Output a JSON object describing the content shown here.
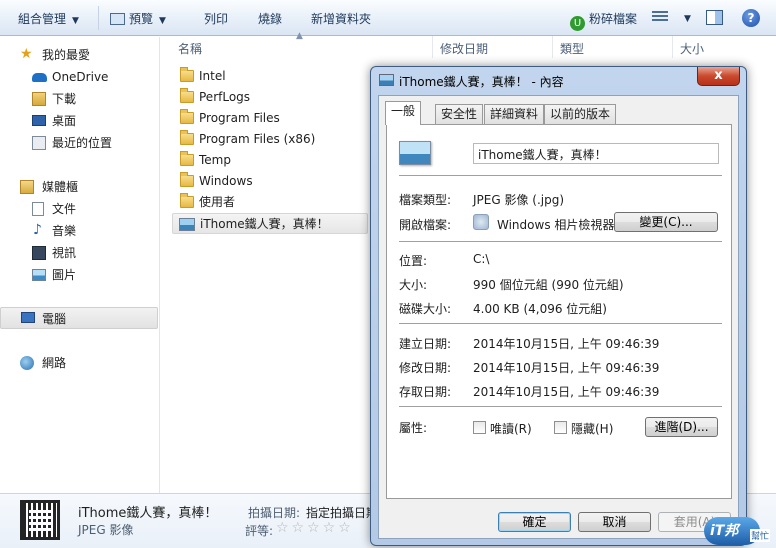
{
  "toolbar": {
    "organize": "組合管理",
    "preview": "預覽",
    "print": "列印",
    "burn": "燒錄",
    "new_folder": "新增資料夾",
    "shred": "粉碎檔案",
    "help": "?"
  },
  "sidebar": {
    "favorites": "我的最愛",
    "onedrive": "OneDrive",
    "downloads": "下載",
    "desktop": "桌面",
    "recent": "最近的位置",
    "libraries": "媒體櫃",
    "documents": "文件",
    "music": "音樂",
    "videos": "視訊",
    "pictures": "圖片",
    "computer": "電腦",
    "network": "網路"
  },
  "columns": {
    "name": "名稱",
    "modified": "修改日期",
    "type": "類型",
    "size": "大小"
  },
  "files": [
    {
      "name": "Intel",
      "kind": "folder"
    },
    {
      "name": "PerfLogs",
      "kind": "folder"
    },
    {
      "name": "Program Files",
      "kind": "folder"
    },
    {
      "name": "Program Files (x86)",
      "kind": "folder"
    },
    {
      "name": "Temp",
      "kind": "folder"
    },
    {
      "name": "Windows",
      "kind": "folder"
    },
    {
      "name": "使用者",
      "kind": "folder"
    },
    {
      "name": "iThome鐵人賽，真棒！",
      "kind": "image"
    }
  ],
  "details": {
    "title": "iThome鐵人賽，真棒！",
    "type": "JPEG 影像",
    "date_taken_label": "拍攝日期:",
    "date_taken_value": "指定拍攝日期",
    "rating_label": "評等:",
    "rating_value": 0
  },
  "dialog": {
    "title": "iThome鐵人賽，真棒！ - 內容",
    "close": "x",
    "tabs": [
      "一般",
      "安全性",
      "詳細資料",
      "以前的版本"
    ],
    "active_tab": "一般",
    "file_name": "iThome鐵人賽，真棒！",
    "type_label": "檔案類型:",
    "type_value": "JPEG 影像 (.jpg)",
    "opens_label": "開啟檔案:",
    "opens_value": "Windows 相片檢視器",
    "change_button": "變更(C)...",
    "location_label": "位置:",
    "location_value": "C:\\",
    "size_label": "大小:",
    "size_value": "990 個位元組 (990 位元組)",
    "disk_label": "磁碟大小:",
    "disk_value": "4.00 KB (4,096 位元組)",
    "created_label": "建立日期:",
    "created_value": "2014年10月15日, 上午 09:46:39",
    "modified_label": "修改日期:",
    "modified_value": "2014年10月15日, 上午 09:46:39",
    "accessed_label": "存取日期:",
    "accessed_value": "2014年10月15日, 上午 09:46:39",
    "attr_label": "屬性:",
    "readonly_label": "唯讀(R)",
    "readonly_checked": false,
    "hidden_label": "隱藏(H)",
    "hidden_checked": false,
    "advanced_button": "進階(D)...",
    "ok_button": "確定",
    "cancel_button": "取消",
    "apply_button": "套用(A)"
  },
  "watermark": {
    "badge": "iT邦",
    "sub": "幫忙"
  }
}
